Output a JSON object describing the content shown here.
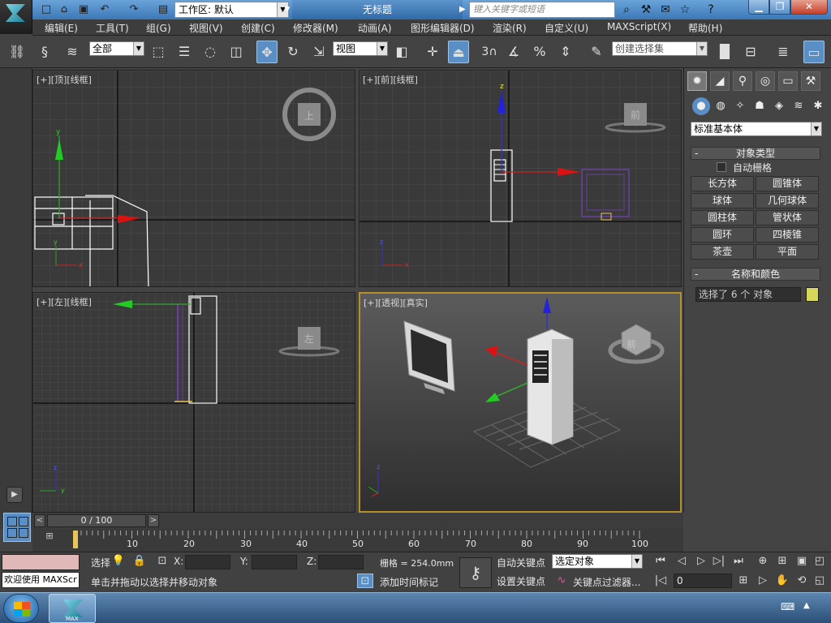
{
  "titlebar": {
    "workspace_label": "工作区: 默认",
    "doc_title": "无标题",
    "search_placeholder": "键入关键字或短语"
  },
  "menu": [
    "编辑(E)",
    "工具(T)",
    "组(G)",
    "视图(V)",
    "创建(C)",
    "修改器(M)",
    "动画(A)",
    "图形编辑器(D)",
    "渲染(R)",
    "自定义(U)",
    "MAXScript(X)",
    "帮助(H)"
  ],
  "toolbar": {
    "filter_value": "全部",
    "refcoord_value": "视图",
    "snap_angle": "3",
    "named_selection_placeholder": "创建选择集"
  },
  "viewports": {
    "top": {
      "label": "[+][顶][线框]",
      "cube_face": "上"
    },
    "front": {
      "label": "[+][前][线框]",
      "cube_face": "前"
    },
    "left": {
      "label": "[+][左][线框]",
      "cube_face": "左"
    },
    "persp": {
      "label": "[+][透视][真实]",
      "cube_face": "前"
    }
  },
  "command_panel": {
    "category_value": "标准基本体",
    "object_type_title": "对象类型",
    "autogrid_label": "自动栅格",
    "buttons": [
      "长方体",
      "圆锥体",
      "球体",
      "几何球体",
      "圆柱体",
      "管状体",
      "圆环",
      "四棱锥",
      "茶壶",
      "平面"
    ],
    "name_color_title": "名称和颜色",
    "name_value": "选择了 6 个 对象",
    "color": "#d6d65a"
  },
  "timeline": {
    "frame_counter": "0 / 100",
    "ticks": [
      "10",
      "20",
      "30",
      "40",
      "50",
      "60",
      "70",
      "80",
      "90",
      "100"
    ]
  },
  "status": {
    "script_listener": "欢迎使用 MAXScr",
    "selected_label": "选择",
    "x_label": "X:",
    "y_label": "Y:",
    "z_label": "Z:",
    "grid_label": "栅格 = 254.0mm",
    "prompt": "单击并拖动以选择并移动对象",
    "add_time_tag": "添加时间标记",
    "auto_key": "自动关键点",
    "set_key": "设置关键点",
    "key_mode_value": "选定对象",
    "key_filters": "关键点过滤器...",
    "current_frame": "0"
  },
  "taskbar": {
    "app_label": "MAX"
  }
}
